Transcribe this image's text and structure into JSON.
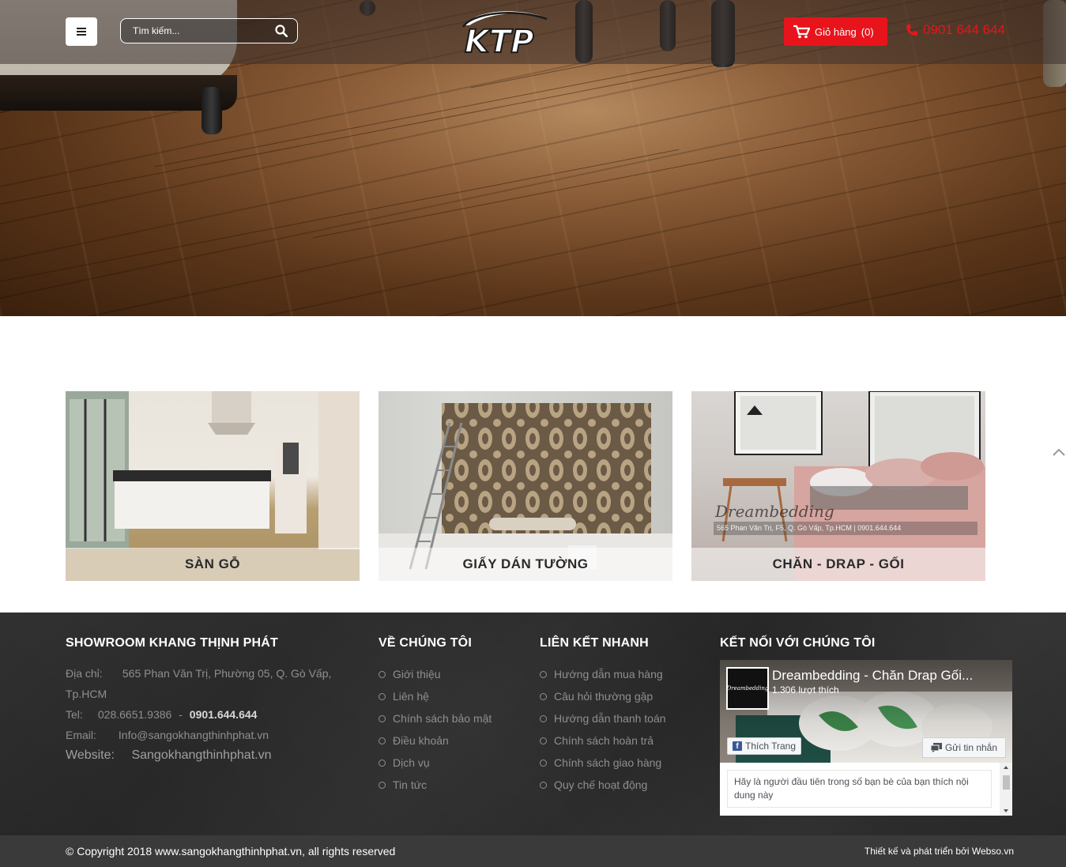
{
  "header": {
    "search_placeholder": "Tìm kiếm...",
    "logo_text": "KTP",
    "cart_label": "Giỏ hàng",
    "cart_count": "(0)",
    "phone": "0901 644 644"
  },
  "categories": [
    {
      "label": "SÀN GỖ"
    },
    {
      "label": "GIẤY DÁN TƯỜNG"
    },
    {
      "label": "CHĂN - DRAP - GỐI"
    }
  ],
  "category_overlay": {
    "brand": "Dreambedding",
    "address": "565 Phan Văn Trị, F5, Q. Gò Vấp, Tp.HCM | 0901.644.644"
  },
  "footer": {
    "showroom": {
      "title": "SHOWROOM KHANG THỊNH PHÁT",
      "address_label": "Địa chỉ:",
      "address_value": "565 Phan Văn Trị, Phường 05, Q. Gò Vấp,",
      "address_value2": "Tp.HCM",
      "tel_label": "Tel:",
      "tel_value": "028.6651.9386",
      "tel_sep": "-",
      "tel_mobile": "0901.644.644",
      "email_label": "Email:",
      "email_value": "Info@sangokhangthinhphat.vn",
      "website_label": "Website:",
      "website_value": "Sangokhangthinhphat.vn"
    },
    "about": {
      "title": "VỀ CHÚNG TÔI",
      "items": [
        "Giới thiệu",
        "Liên hệ",
        "Chính sách bảo mật",
        "Điều khoản",
        "Dịch vụ",
        "Tin tức"
      ]
    },
    "quicklinks": {
      "title": "LIÊN KẾT NHANH",
      "items": [
        "Hướng dẫn mua hàng",
        "Câu hỏi thường gặp",
        "Hướng dẫn thanh toán",
        "Chính sách hoàn trả",
        "Chính sách giao hàng",
        "Quy chế hoạt động"
      ]
    },
    "connect": {
      "title": "KẾT NỐI VỚI CHÚNG TÔI",
      "fb_page_name": "Dreambedding - Chăn Drap Gối...",
      "fb_likes": "1.306 lượt thích",
      "fb_avatar_text": "Dreambedding",
      "fb_like_label": "Thích Trang",
      "fb_message_label": "Gửi tin nhắn",
      "fb_feed_text": "Hãy là người đầu tiên trong số bạn bè của bạn thích nội dung này"
    },
    "copyright": "© Copyright 2018 www.sangokhangthinhphat.vn, all rights reserved",
    "credit": "Thiết kế và phát triển bởi Webso.vn"
  },
  "colors": {
    "accent_red": "#e8141c",
    "footer_bg": "#262626",
    "bottom_bar": "#3a3a3a"
  },
  "icons": {
    "menu": "menu-icon",
    "search": "search-icon",
    "cart": "cart-icon",
    "phone": "phone-icon",
    "scroll_up": "chevron-up-icon",
    "facebook": "facebook-icon",
    "message": "message-icon"
  }
}
